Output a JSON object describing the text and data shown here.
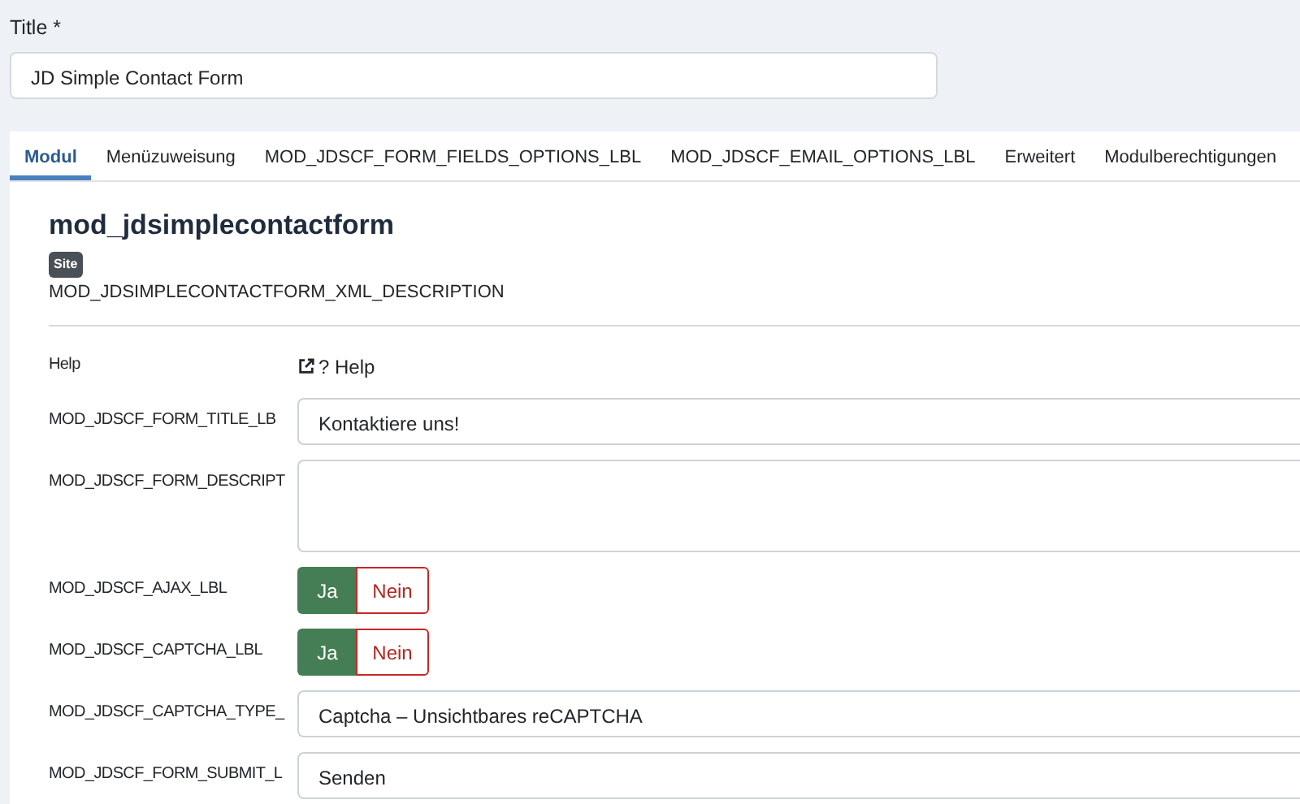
{
  "title_field": {
    "label": "Title *",
    "value": "JD Simple Contact Form"
  },
  "tabs": [
    {
      "label": "Modul",
      "selected": true
    },
    {
      "label": "Menüzuweisung",
      "selected": false
    },
    {
      "label": "MOD_JDSCF_FORM_FIELDS_OPTIONS_LBL",
      "selected": false
    },
    {
      "label": "MOD_JDSCF_EMAIL_OPTIONS_LBL",
      "selected": false
    },
    {
      "label": "Erweitert",
      "selected": false
    },
    {
      "label": "Modulberechtigungen",
      "selected": false
    }
  ],
  "module": {
    "name": "mod_jdsimplecontactform",
    "badge": "Site",
    "description": "MOD_JDSIMPLECONTACTFORM_XML_DESCRIPTION"
  },
  "fields": [
    {
      "kind": "link",
      "label": "Help",
      "value": "? Help"
    },
    {
      "kind": "text",
      "label": "MOD_JDSCF_FORM_TITLE_LB",
      "value": "Kontaktiere uns!"
    },
    {
      "kind": "textarea",
      "label": "MOD_JDSCF_FORM_DESCRIPT"
    },
    {
      "kind": "toggle",
      "label": "MOD_JDSCF_AJAX_LBL",
      "options": [
        {
          "label": "Ja",
          "selected": true
        },
        {
          "label": "Nein",
          "selected": false
        }
      ]
    },
    {
      "kind": "toggle",
      "label": "MOD_JDSCF_CAPTCHA_LBL",
      "options": [
        {
          "label": "Ja",
          "selected": true
        },
        {
          "label": "Nein",
          "selected": false
        }
      ]
    },
    {
      "kind": "select",
      "label": "MOD_JDSCF_CAPTCHA_TYPE_",
      "value": "Captcha – Unsichtbares reCAPTCHA"
    },
    {
      "kind": "text",
      "label": "MOD_JDSCF_FORM_SUBMIT_L",
      "value": "Senden"
    }
  ]
}
